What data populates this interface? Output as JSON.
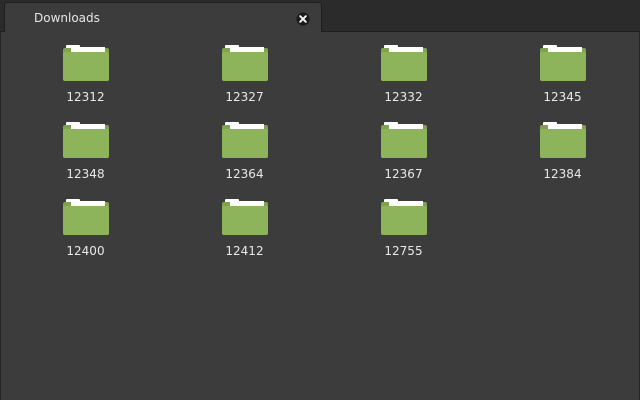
{
  "tab": {
    "title": "Downloads"
  },
  "colors": {
    "folder_body": "#8db45a",
    "folder_back": "#7fa24f",
    "paper": "#ffffff"
  },
  "icons": {
    "close": "close-icon",
    "folder": "folder-icon"
  },
  "items": [
    {
      "label": "12312"
    },
    {
      "label": "12327"
    },
    {
      "label": "12332"
    },
    {
      "label": "12345"
    },
    {
      "label": "12348"
    },
    {
      "label": "12364"
    },
    {
      "label": "12367"
    },
    {
      "label": "12384"
    },
    {
      "label": "12400"
    },
    {
      "label": "12412"
    },
    {
      "label": "12755"
    }
  ]
}
